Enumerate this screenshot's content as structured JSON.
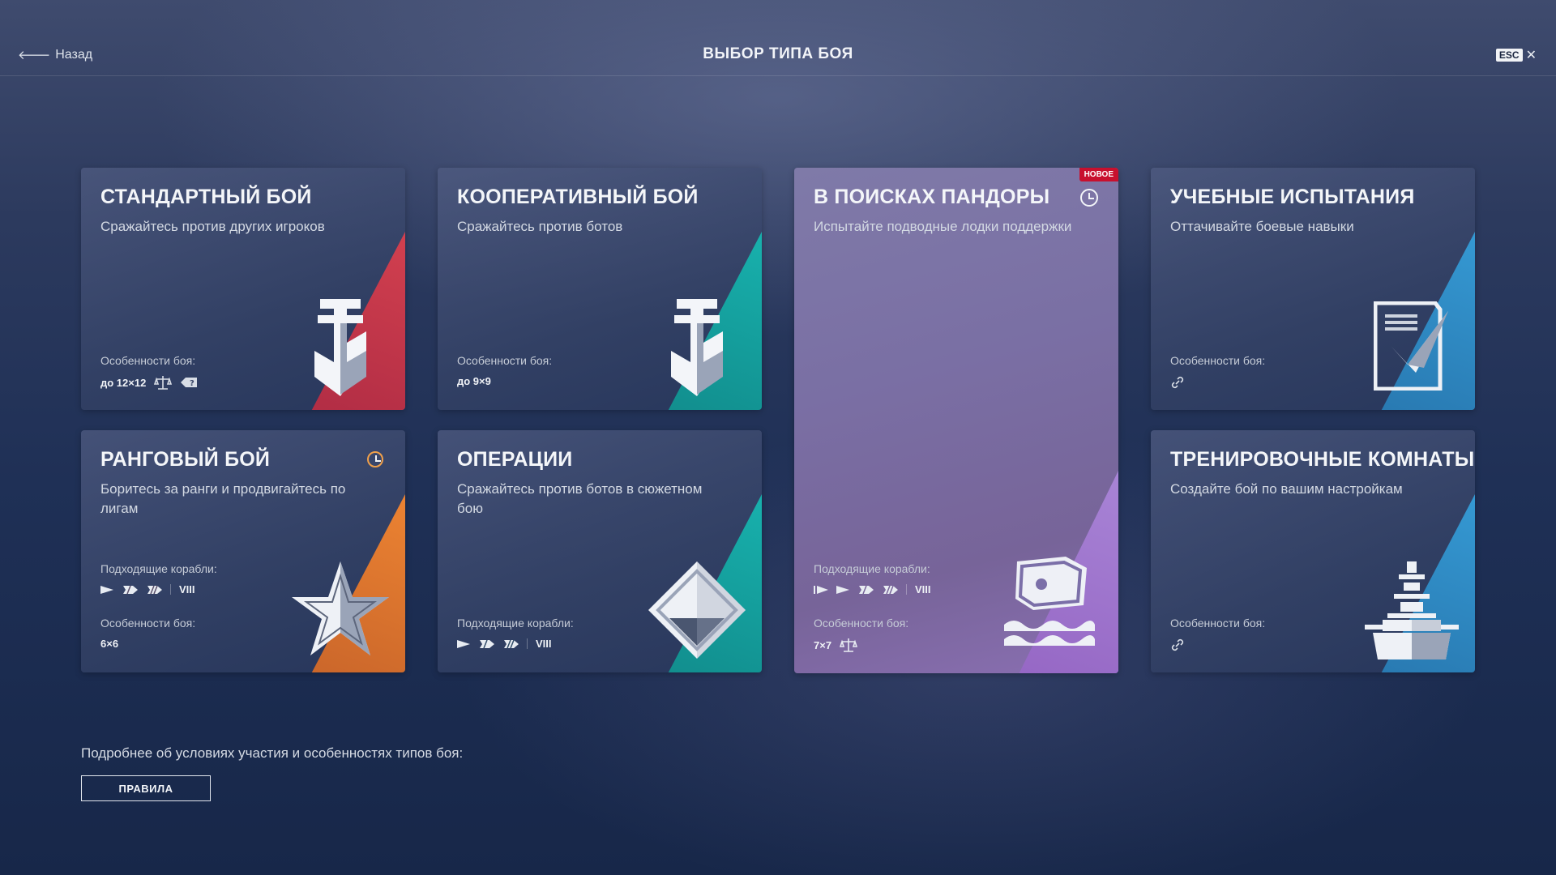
{
  "header": {
    "back_label": "Назад",
    "title": "ВЫБОР ТИПА БОЯ",
    "esc_label": "ESC",
    "close_symbol": "✕"
  },
  "cards": [
    {
      "title": "СТАНДАРТНЫЙ БОЙ",
      "subtitle": "Сражайтесь против других игроков",
      "features_label": "Особенности боя:",
      "features_value": "до 12×12",
      "accent": "#c83a4a",
      "icon": "anchor-icon"
    },
    {
      "title": "КООПЕРАТИВНЫЙ БОЙ",
      "subtitle": "Сражайтесь против ботов",
      "features_label": "Особенности боя:",
      "features_value": "до 9×9",
      "accent": "#16a3a0",
      "icon": "anchor-icon"
    },
    {
      "title": "В ПОИСКАХ ПАНДОРЫ",
      "subtitle": "Испытайте подводные лодки поддержки",
      "badge": "НОВОЕ",
      "ships_label": "Подходящие корабли:",
      "ships_tier": "VIII",
      "features_label": "Особенности боя:",
      "features_value": "7×7",
      "accent": "#9d6fc6",
      "icon": "treasure-chest-icon"
    },
    {
      "title": "УЧЕБНЫЕ ИСПЫТАНИЯ",
      "subtitle": "Оттачивайте боевые навыки",
      "features_label": "Особенности боя:",
      "accent": "#2f8ec9",
      "icon": "checklist-icon"
    },
    {
      "title": "РАНГОВЫЙ БОЙ",
      "subtitle": "Боритесь за ранги и продвигайтесь по лигам",
      "ships_label": "Подходящие корабли:",
      "ships_tier": "VIII",
      "features_label": "Особенности боя:",
      "features_value": "6×6",
      "accent": "#e0752c",
      "icon": "star-icon"
    },
    {
      "title": "ОПЕРАЦИИ",
      "subtitle": "Сражайтесь против ботов в сюжетном бою",
      "ships_label": "Подходящие корабли:",
      "ships_tier": "VIII",
      "accent": "#16a3a0",
      "icon": "diamond-icon"
    },
    {
      "title": "ТРЕНИРОВОЧНЫЕ КОМНАТЫ",
      "subtitle": "Создайте бой по вашим настройкам",
      "features_label": "Особенности боя:",
      "accent": "#2f8ec9",
      "icon": "battleship-icon"
    }
  ],
  "footer": {
    "info_text": "Подробнее об условиях участия и особенностях типов боя:",
    "rules_button": "ПРАВИЛА"
  }
}
